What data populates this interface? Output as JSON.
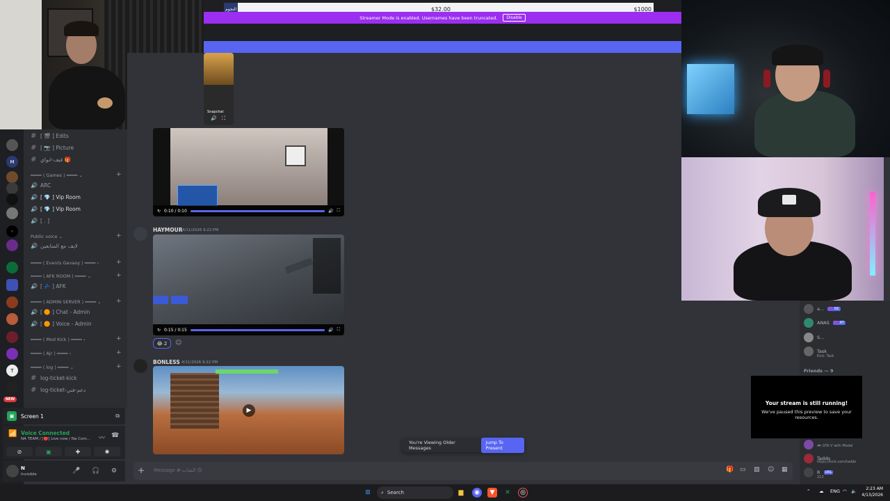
{
  "donation": {
    "avatar_text": "النجوم",
    "amount": "$32.00",
    "goal": "$1000"
  },
  "streamer_banner": {
    "text": "Streamer Mode is enabled. Usernames have been truncated.",
    "disable_label": "Disable"
  },
  "overlay_snap": {
    "label": "Snapchat"
  },
  "servers": {
    "new_badge": "NEW"
  },
  "channels": {
    "items": [
      {
        "name": "edits",
        "label": "[ 🎬 ] Edits",
        "type": "text"
      },
      {
        "name": "picture",
        "label": "[ 📷 ] Picture",
        "type": "text"
      },
      {
        "name": "arabic-fun",
        "label": "قيف-انواي 🎁",
        "type": "text"
      }
    ],
    "games_category": "Games",
    "games": [
      {
        "label": "ARC",
        "type": "voice"
      },
      {
        "label": "[ 💎 ] Vip Room",
        "type": "voice"
      },
      {
        "label": "[ 💎 ] Vip Room",
        "type": "voice"
      },
      {
        "label": "[ . ]",
        "type": "voice"
      }
    ],
    "public_voice_category": "Public voice",
    "public_voice": [
      {
        "label": "لايف مع المتابعين",
        "type": "voice"
      }
    ],
    "events_category": "Events Gevaoy",
    "afk_category": "AFK ROOM",
    "afk": [
      {
        "label": "[ 💤 ] AFK",
        "type": "voice"
      }
    ],
    "admin_category": "ADMIN SERVER",
    "admin": [
      {
        "label": "[ 🟠 ] Chat - Admin",
        "type": "voice"
      },
      {
        "label": "[ 🟠 ] Voice - Admin",
        "type": "voice"
      }
    ],
    "modkick_category": "Mod Kick",
    "ajr_category": "Ajr",
    "log_category": "log",
    "logs": [
      {
        "label": "log-ticket-kick",
        "type": "text"
      },
      {
        "label": "log-ticket-دعم-فني",
        "type": "text"
      }
    ]
  },
  "screen_share": {
    "label": "Screen 1"
  },
  "voice": {
    "title": "Voice Connected",
    "subtitle": "NA TEAM / [🔴] Live now / Na Com..."
  },
  "user": {
    "name": "N",
    "status": "Invisible"
  },
  "messages": [
    {
      "author": "",
      "timestamp": "",
      "video_time": "0:10 / 0:10",
      "progress": 1.0
    },
    {
      "author": "HAYMOUR",
      "timestamp": "4/11/2026 9:22 PM",
      "video_time": "0:15 / 0:15",
      "progress": 1.0,
      "reaction_emoji": "😂",
      "reaction_count": "2"
    },
    {
      "author": "BONLESS",
      "timestamp": "4/11/2026 9:22 PM"
    }
  ],
  "older_banner": {
    "text": "You're Viewing Older Messages",
    "jump_label": "Jump To Present"
  },
  "composer": {
    "placeholder": "Message #-الشات 😊"
  },
  "members": {
    "list": [
      {
        "name": "a...",
        "tag": "💜 NC",
        "sub": ""
      },
      {
        "name": "ANAS",
        "tag": "💜 RT",
        "sub": ""
      },
      {
        "name": "S...",
        "tag": "",
        "sub": ""
      },
      {
        "name": "Task",
        "tag": "",
        "sub": "Kick: Task"
      }
    ],
    "friends_header": "Friends — 9",
    "bottom": [
      {
        "name": "",
        "sub": "🎮 GTA V with Medal"
      },
      {
        "name": "Taddo",
        "sub": "https://kick.com/taddo"
      },
      {
        "name": "R",
        "tag": "URL",
        "sub": "213"
      }
    ]
  },
  "stream_paused": {
    "title": "Your stream is still running!",
    "body": "We've paused this preview to save your resources."
  },
  "taskbar": {
    "search_label": "Search",
    "lang": "ENG",
    "time": "2:23 AM",
    "date": "4/13/2026"
  }
}
